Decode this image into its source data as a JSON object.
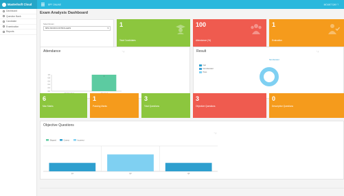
{
  "header": {
    "app_name": "Masterlsoft Cloud",
    "top_link": "BPF ONLINE",
    "user": "MOUNT DAY ?"
  },
  "sidebar": {
    "items": [
      {
        "label": "Dashboard",
        "icon": "dashboard-icon"
      },
      {
        "label": "Question Bank",
        "icon": "book-icon"
      },
      {
        "label": "Candidate",
        "icon": "user-icon"
      },
      {
        "label": "Examination",
        "icon": "exam-icon"
      },
      {
        "label": "Reports",
        "icon": "report-icon"
      }
    ]
  },
  "page": {
    "title": "Exam Analysis Dashboard"
  },
  "exam_select": {
    "label": "Select Exam",
    "value": "8051 MICROCONTROLLERS"
  },
  "stat_cards": [
    {
      "value": "1",
      "label": "Total Candidates",
      "color": "#8cc63e",
      "icon": "graduate-icon"
    },
    {
      "value": "100",
      "label": "Attendance (%)",
      "color": "#ef5b4f",
      "icon": "group-icon"
    },
    {
      "value": "1",
      "label": "Evaluation",
      "color": "#f59b1c",
      "icon": "user-check-icon"
    }
  ],
  "attendance": {
    "title": "Attendance",
    "chart_data": {
      "type": "bar",
      "categories": [
        "Not Attended",
        "Appeared"
      ],
      "values": [
        0,
        1
      ],
      "ylim": [
        0,
        1
      ],
      "yticks": [
        "1.0",
        "0.8",
        "0.6",
        "0.4",
        "0.2",
        "0.0"
      ],
      "data_labels": [
        "",
        "1"
      ],
      "color": "#5ccba1"
    }
  },
  "result": {
    "title": "Result",
    "chart_data": {
      "type": "pie",
      "labels": [
        "Fail",
        "Not Attended",
        "Pass"
      ],
      "values": [
        0,
        0,
        1
      ],
      "colors": [
        "#2e9fcf",
        "#3aa0d8",
        "#7fd0f2"
      ],
      "annotation": "Not Attended"
    }
  },
  "summary_cards": [
    {
      "value": "6",
      "label": "Max Marks",
      "color": "#8cc63e"
    },
    {
      "value": "1",
      "label": "Passing Marks",
      "color": "#f59b1c"
    },
    {
      "value": "3",
      "label": "Total Questions",
      "color": "#8cc63e"
    },
    {
      "value": "3",
      "label": "Objective Questions",
      "color": "#ef5b4f"
    },
    {
      "value": "0",
      "label": "Descriptive Questions",
      "color": "#f59b1c"
    }
  ],
  "objective": {
    "title": "Objective Questions",
    "chart_data": {
      "type": "bar",
      "categories": [
        "Q1",
        "Q2",
        "Q3"
      ],
      "series": [
        {
          "name": "Skipped",
          "color": "#5ccba1",
          "values": [
            0,
            0,
            0
          ]
        },
        {
          "name": "Correct",
          "color": "#2e9fcf",
          "values": [
            1,
            0,
            1
          ]
        },
        {
          "name": "Incorrect",
          "color": "#7fd0f2",
          "values": [
            0,
            2,
            0
          ]
        }
      ],
      "ylim": [
        0,
        3
      ]
    }
  }
}
